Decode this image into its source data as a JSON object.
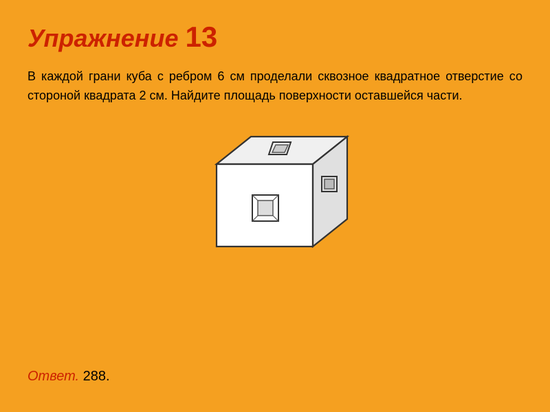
{
  "title": {
    "label": "Упражнение",
    "number": "13"
  },
  "problem": {
    "text": "В каждой грани куба с ребром 6 см проделали сквозное квадратное отверстие со стороной квадрата 2 см. Найдите площадь поверхности оставшейся части."
  },
  "answer": {
    "label": "Ответ.",
    "value": " 288."
  },
  "colors": {
    "background": "#F5A020",
    "title": "#CC2200",
    "answer_label": "#CC2200"
  }
}
